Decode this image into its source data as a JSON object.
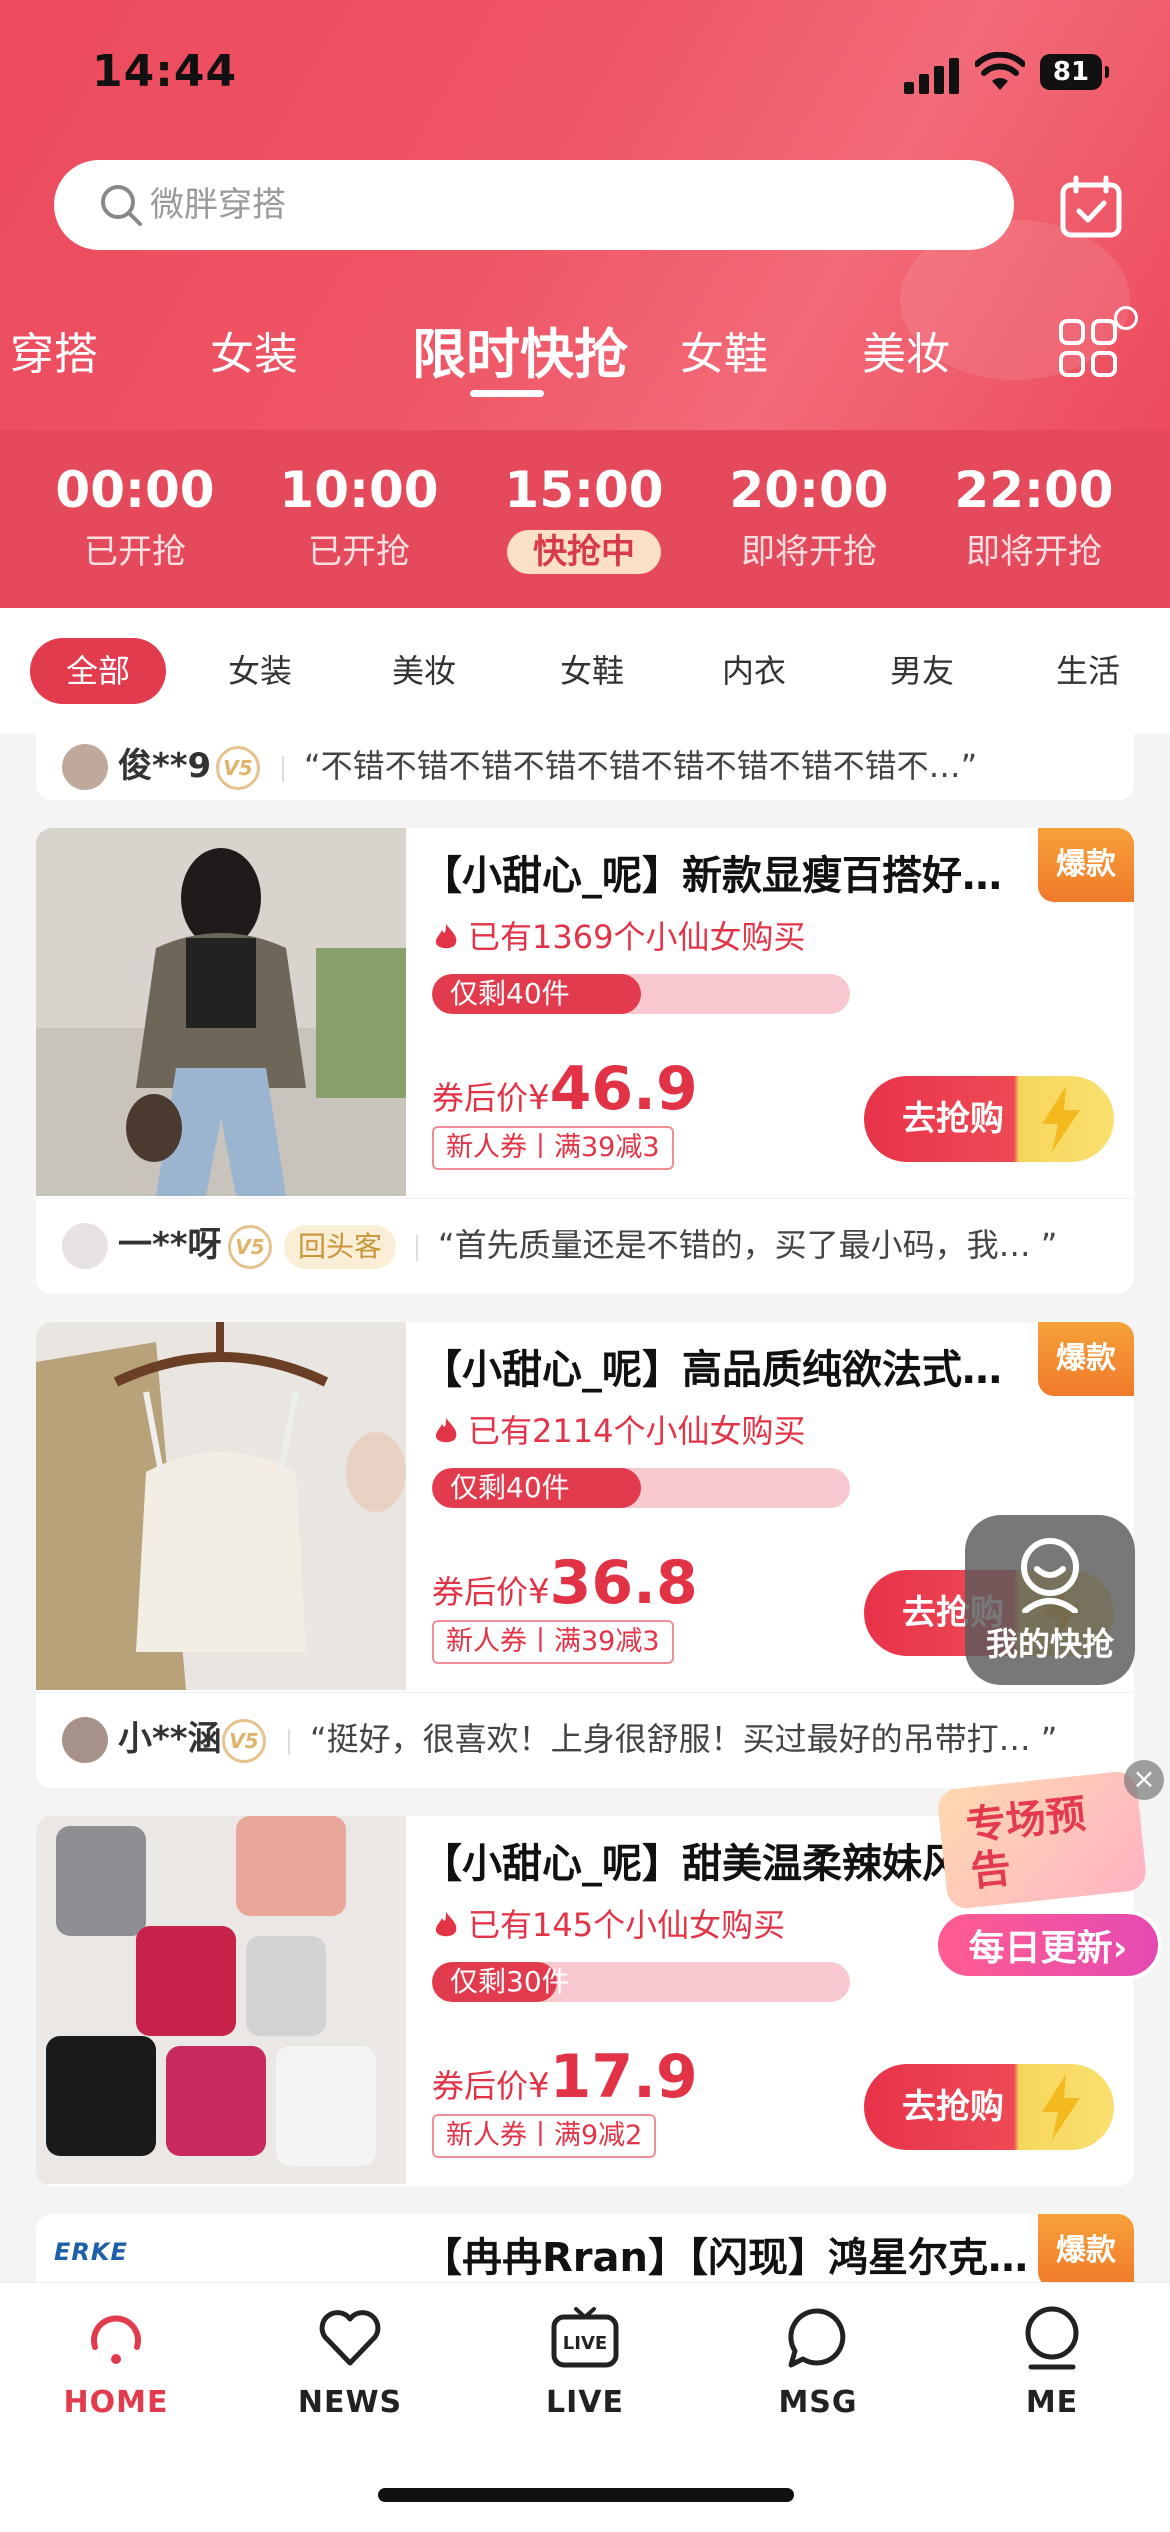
{
  "status": {
    "time": "14:44",
    "battery": "81"
  },
  "search": {
    "placeholder": "微胖穿搭"
  },
  "categories": [
    {
      "label": "穿搭"
    },
    {
      "label": "女装"
    },
    {
      "label": "限时快抢"
    },
    {
      "label": "女鞋"
    },
    {
      "label": "美妆"
    }
  ],
  "time_slots": [
    {
      "time": "00:00",
      "status": "已开抢"
    },
    {
      "time": "10:00",
      "status": "已开抢"
    },
    {
      "time": "15:00",
      "status": "快抢中"
    },
    {
      "time": "20:00",
      "status": "即将开抢"
    },
    {
      "time": "22:00",
      "status": "即将开抢"
    }
  ],
  "filters": [
    "全部",
    "女装",
    "美妆",
    "女鞋",
    "内衣",
    "男友",
    "生活"
  ],
  "top_review": {
    "name": "俊**9",
    "level": "V5",
    "text": "“不错不错不错不错不错不错不错不错不错不…”"
  },
  "products": [
    {
      "title": "【小甜心_呢】新款显瘦百搭好…",
      "badge": "爆款",
      "bought": "已有1369个小仙女购买",
      "remaining_label": "仅剩40件",
      "remaining_fraction": 0.5,
      "price_label": "券后价",
      "currency": "¥",
      "price": "46.9",
      "coupon": "新人券丨满39减3",
      "buy_label": "去抢购",
      "review": {
        "name": "一**呀",
        "level": "V5",
        "tag": "回头客",
        "text": "“首先质量还是不错的，买了最小码，我…  ”"
      }
    },
    {
      "title": "【小甜心_呢】高品质纯欲法式…",
      "badge": "爆款",
      "bought": "已有2114个小仙女购买",
      "remaining_label": "仅剩40件",
      "remaining_fraction": 0.5,
      "price_label": "券后价",
      "currency": "¥",
      "price": "36.8",
      "coupon": "新人券丨满39减3",
      "buy_label": "去抢购",
      "review": {
        "name": "小**涵",
        "level": "V5",
        "text": "“挺好，很喜欢！上身很舒服！买过最好的吊带打…  ”"
      }
    },
    {
      "title": "【小甜心_呢】甜美温柔辣妹风",
      "badge": "",
      "bought": "已有145个小仙女购买",
      "remaining_label": "仅剩30件",
      "remaining_fraction": 0.3,
      "price_label": "券后价",
      "currency": "¥",
      "price": "17.9",
      "coupon": "新人券丨满9减2",
      "buy_label": "去抢购"
    },
    {
      "title": "【冉冉Rran】【闪现】鸿星尔克男鞋…",
      "badge": "爆款",
      "brand": "ERKE"
    }
  ],
  "floating": {
    "my_flash": "我的快抢",
    "promo_line1": "专场预告",
    "promo_line2": "每日更新›"
  },
  "nav": [
    {
      "label": "HOME"
    },
    {
      "label": "NEWS"
    },
    {
      "label": "LIVE"
    },
    {
      "label": "MSG"
    },
    {
      "label": "ME"
    }
  ],
  "colors": {
    "brand_red": "#e23b4d",
    "header_red": "#ec4a5d",
    "hot_orange": "#f07a2a"
  }
}
